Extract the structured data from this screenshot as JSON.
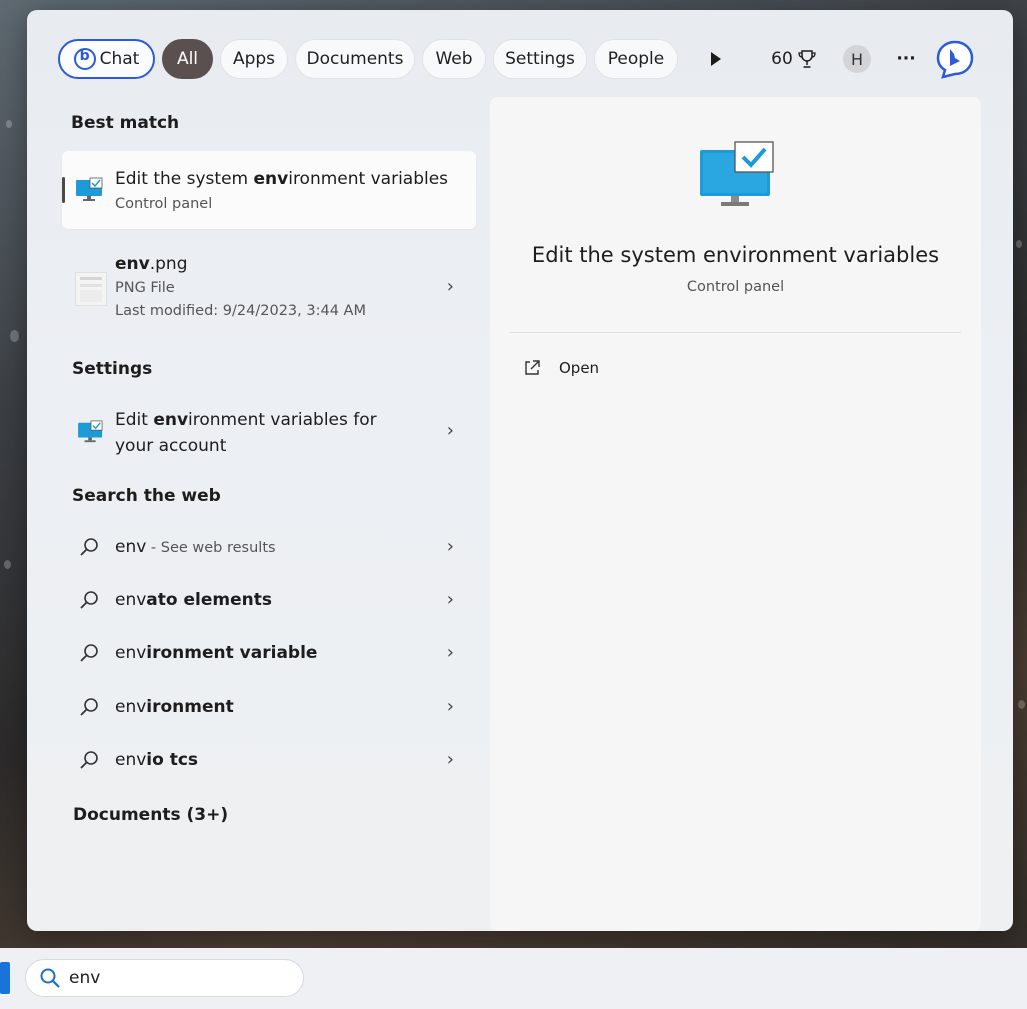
{
  "filter_bar": {
    "chat_label": "Chat",
    "tabs": [
      "All",
      "Apps",
      "Documents",
      "Web",
      "Settings",
      "People"
    ],
    "active_tab": "All",
    "rewards_points": "60",
    "avatar_initial": "H",
    "more_label": "···"
  },
  "sections": {
    "best_match": "Best match",
    "settings": "Settings",
    "search_web": "Search the web",
    "documents": "Documents (3+)"
  },
  "best_match": {
    "title_pre": "Edit the system ",
    "title_bold": "env",
    "title_post": "ironment variables",
    "subtitle": "Control panel"
  },
  "file_result": {
    "name_bold": "env",
    "name_rest": ".png",
    "type": "PNG File",
    "modified": "Last modified: 9/24/2023, 3:44 AM"
  },
  "settings_result": {
    "line1_pre": "Edit ",
    "line1_bold": "env",
    "line1_post": "ironment variables for",
    "line2": "your account"
  },
  "web_results": [
    {
      "plain": "env",
      "bold": "",
      "hint": " - See web results"
    },
    {
      "plain": "env",
      "bold": "ato elements",
      "hint": ""
    },
    {
      "plain": "env",
      "bold": "ironment variable",
      "hint": ""
    },
    {
      "plain": "env",
      "bold": "ironment",
      "hint": ""
    },
    {
      "plain": "env",
      "bold": "io tcs",
      "hint": ""
    }
  ],
  "preview": {
    "title": "Edit the system environment variables",
    "subtitle": "Control panel",
    "action_open": "Open"
  },
  "taskbar": {
    "search_value": "env"
  },
  "colors": {
    "accent": "#2b5bd6",
    "active_tab": "#5b5050",
    "monitor": "#1e9ad6"
  }
}
